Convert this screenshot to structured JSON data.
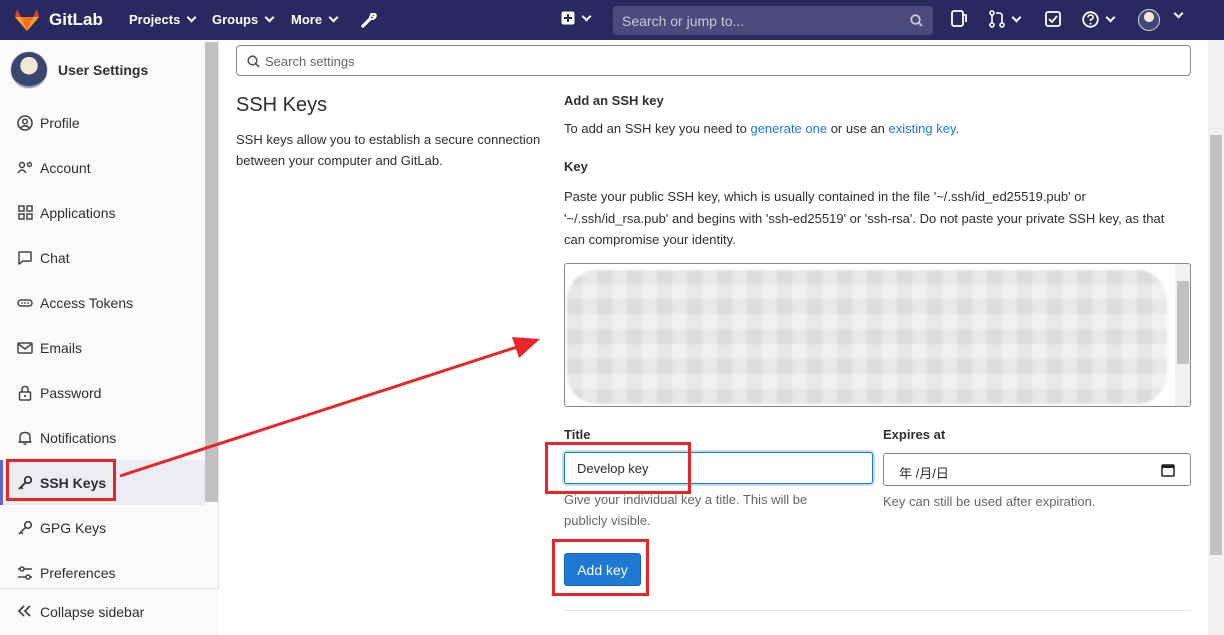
{
  "navbar": {
    "brand": "GitLab",
    "projects": "Projects",
    "groups": "Groups",
    "more": "More",
    "search_placeholder": "Search or jump to..."
  },
  "sidebar": {
    "title": "User Settings",
    "items": [
      {
        "label": "Profile",
        "icon": "profile-icon"
      },
      {
        "label": "Account",
        "icon": "account-icon"
      },
      {
        "label": "Applications",
        "icon": "applications-icon"
      },
      {
        "label": "Chat",
        "icon": "chat-icon"
      },
      {
        "label": "Access Tokens",
        "icon": "access-tokens-icon"
      },
      {
        "label": "Emails",
        "icon": "email-icon"
      },
      {
        "label": "Password",
        "icon": "lock-icon"
      },
      {
        "label": "Notifications",
        "icon": "bell-icon"
      },
      {
        "label": "SSH Keys",
        "icon": "key-icon",
        "active": true
      },
      {
        "label": "GPG Keys",
        "icon": "key-icon"
      },
      {
        "label": "Preferences",
        "icon": "preferences-icon"
      }
    ],
    "collapse": "Collapse sidebar"
  },
  "main": {
    "search_placeholder": "Search settings",
    "section_title": "SSH Keys",
    "section_desc": "SSH keys allow you to establish a secure connection between your computer and GitLab.",
    "add_title": "Add an SSH key",
    "add_line_prefix": "To add an SSH key you need to ",
    "add_link_generate": "generate one",
    "add_line_mid": " or use an ",
    "add_link_existing": "existing key",
    "add_line_suffix": ".",
    "key_label": "Key",
    "key_help": "Paste your public SSH key, which is usually contained in the file '~/.ssh/id_ed25519.pub' or '~/.ssh/id_rsa.pub' and begins with 'ssh-ed25519' or 'ssh-rsa'. Do not paste your private SSH key, as that can compromise your identity.",
    "title_label": "Title",
    "title_value": "Develop key",
    "title_help": "Give your individual key a title. This will be publicly visible.",
    "expires_label": "Expires at",
    "expires_placeholder": "年 /月/日",
    "expires_help": "Key can still be used after expiration.",
    "add_button": "Add key"
  },
  "colors": {
    "navbar": "#292961",
    "accent": "#1f78d1",
    "annotation": "#e8262a"
  }
}
